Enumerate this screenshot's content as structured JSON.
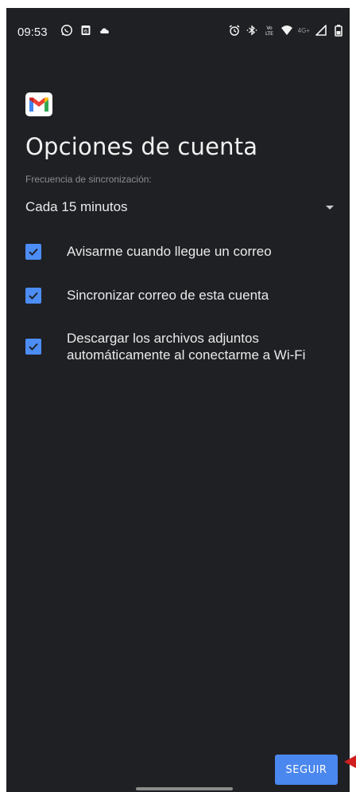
{
  "status_bar": {
    "time": "09:53",
    "network_label": "4G+",
    "left_icons": [
      "whatsapp-icon",
      "calendar-icon",
      "cloud-icon"
    ],
    "right_icons": [
      "alarm-icon",
      "bluetooth-icon",
      "volte-icon",
      "wifi-icon",
      "signal-icon",
      "battery-icon"
    ]
  },
  "app": {
    "logo": "gmail-logo-icon"
  },
  "page": {
    "title": "Opciones de cuenta",
    "sync_frequency_label": "Frecuencia de sincronización:",
    "sync_frequency_value": "Cada 15 minutos"
  },
  "options": [
    {
      "label": "Avisarme cuando llegue un correo",
      "checked": true
    },
    {
      "label": "Sincronizar correo de esta cuenta",
      "checked": true
    },
    {
      "label": "Descargar los archivos adjuntos automáticamente al conectarme a Wi-Fi",
      "checked": true
    }
  ],
  "actions": {
    "continue_label": "SEGUIR"
  },
  "colors": {
    "background": "#1f2024",
    "accent": "#4a87ee",
    "checkbox": "#4c8df5",
    "pointer": "#d11f1f"
  }
}
